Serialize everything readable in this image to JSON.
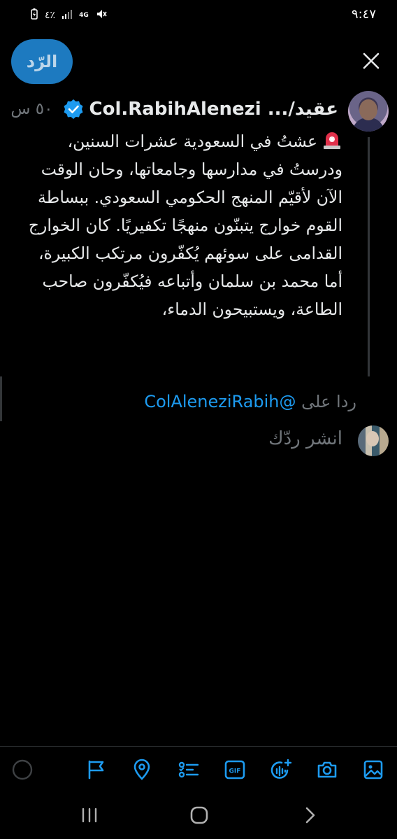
{
  "status_bar": {
    "time": "٩:٤٧",
    "battery": "٤٪",
    "network": "4G"
  },
  "header": {
    "reply_label": "الرّد",
    "close_icon": "close-icon"
  },
  "tweet": {
    "display_name": "عقيد/... Col.RabihAlenezi",
    "verified_icon": "verified-badge-icon",
    "time_ago": "٥٠ س",
    "emoji_icon": "police-siren-emoji",
    "text": "عشتُ في السعودية عشرات السنين، ودرستُ في مدارسها وجامعاتها، وحان الوقت الآن لأقيّم المنهج الحكومي السعودي. ببساطة القوم خوارج يتبنّون منهجًا تكفيريًا. كان الخوارج القدامى على سوئهم يُكفّرون مرتكب الكبيرة، أما محمد بن سلمان وأتباعه فيُكفّرون صاحب الطاعة، ويستبيحون الدماء،"
  },
  "reply_context": {
    "prefix": "ردا على",
    "handle": "@ColAleneziRabih"
  },
  "composer": {
    "placeholder": "انشر ردّك"
  },
  "toolbar": {
    "accent_color": "#1d9bf0",
    "items": [
      "progress-ring",
      "flag-icon",
      "location-icon",
      "poll-icon",
      "gif-icon",
      "voice-icon",
      "camera-icon",
      "image-icon"
    ],
    "gif_label": "GIF"
  },
  "nav": {
    "items": [
      "recent-apps-icon",
      "home-icon",
      "back-icon"
    ]
  }
}
